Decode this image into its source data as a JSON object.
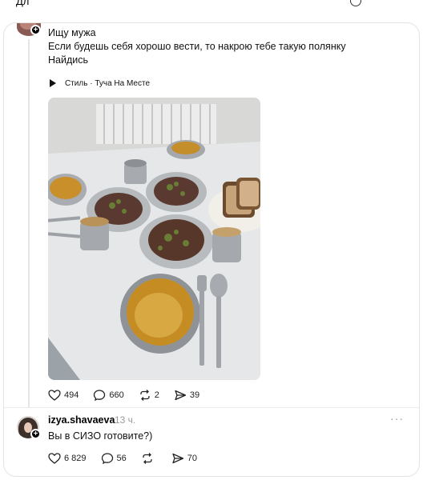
{
  "top_cut": {
    "text": "Дл"
  },
  "post1": {
    "lines": [
      "Ищу мужа",
      "Если будешь себя хорошо вести, то накрою тебе такую полянку",
      "Найдись"
    ],
    "music": {
      "icon": "play-icon",
      "label": "Стиль · Туча На Месте"
    },
    "photo": {
      "kind": "photo-food-table"
    },
    "actions": {
      "likes": "494",
      "comments": "660",
      "reposts": "2",
      "shares": "39"
    }
  },
  "post2": {
    "username": "izya.shavaeva",
    "time": "13 ч.",
    "text": "Вы в СИЗО готовите?)",
    "more": "···",
    "actions": {
      "likes": "6 829",
      "comments": "56",
      "reposts": "",
      "shares": "70"
    }
  }
}
